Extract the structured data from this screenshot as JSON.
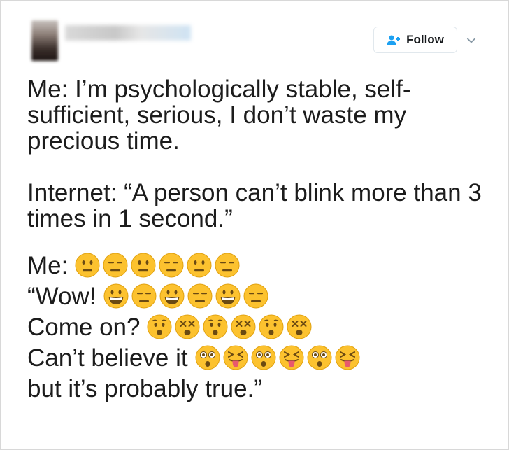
{
  "header": {
    "follow_label": "Follow"
  },
  "tweet": {
    "paragraph1": "Me: I’m psychologically stable, self-sufficient, serious, I don’t waste my precious time.",
    "paragraph2": "Internet: “A person can’t blink more than 3 times in 1 second.”",
    "lines": [
      {
        "text": "Me:",
        "emojis": [
          "neutral-face",
          "expressionless-face",
          "neutral-face",
          "expressionless-face",
          "neutral-face",
          "expressionless-face"
        ]
      },
      {
        "text": "“Wow!",
        "emojis": [
          "grinning-face",
          "expressionless-face",
          "grinning-face",
          "expressionless-face",
          "grinning-face",
          "expressionless-face"
        ]
      },
      {
        "text": "Come on?",
        "emojis": [
          "hushed-face",
          "dizzy-face",
          "hushed-face",
          "dizzy-face",
          "hushed-face",
          "dizzy-face"
        ]
      },
      {
        "text": "Can’t believe it",
        "emojis": [
          "astonished-face",
          "squinting-tongue-face",
          "astonished-face",
          "squinting-tongue-face",
          "astonished-face",
          "squinting-tongue-face"
        ]
      },
      {
        "text": "but it’s probably true.”",
        "emojis": []
      }
    ]
  },
  "colors": {
    "emoji_fill": "#fcc22f",
    "emoji_stroke": "#e0a10f",
    "follow_icon": "#1da1f2",
    "text": "#1c1c1c"
  }
}
